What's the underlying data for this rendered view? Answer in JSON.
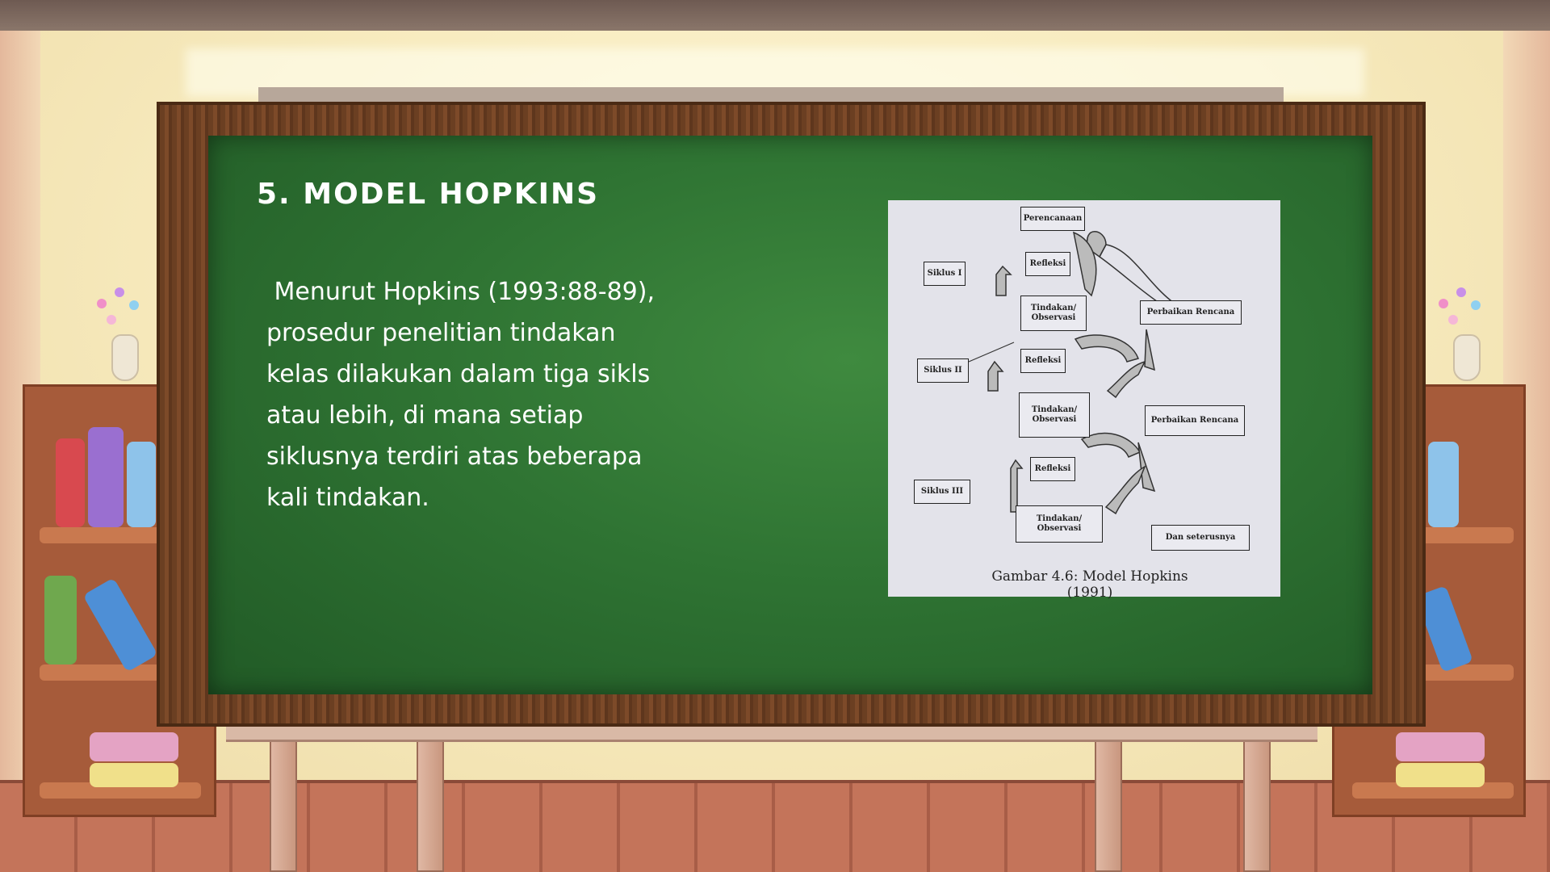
{
  "slide": {
    "title": "5. MODEL HOPKINS",
    "body": " Menurut Hopkins (1993:88-89),\nprosedur penelitian tindakan\nkelas dilakukan dalam tiga sikls\natau lebih, di mana setiap\nsiklusnya terdiri atas beberapa\nkali tindakan."
  },
  "figure": {
    "caption": "Gambar 4.6: Model Hopkins (1991)",
    "boxes": {
      "perencanaan": "Perencanaan",
      "siklus1": "Siklus I",
      "refleksi1": "Refleksi",
      "tindakan1": "Tindakan/\nObservasi",
      "perbaikan1": "Perbaikan Rencana",
      "siklus2": "Siklus II",
      "refleksi2": "Refleksi",
      "tindakan2": "Tindakan/\nObservasi",
      "perbaikan2": "Perbaikan Rencana",
      "refleksi3": "Refleksi",
      "siklus3": "Siklus III",
      "tindakan3": "Tindakan/\nObservasi",
      "seterusnya": "Dan seterusnya"
    }
  },
  "colors": {
    "chalkboard": "#2f7433",
    "frame": "#6b3f22",
    "text": "#ffffff"
  }
}
